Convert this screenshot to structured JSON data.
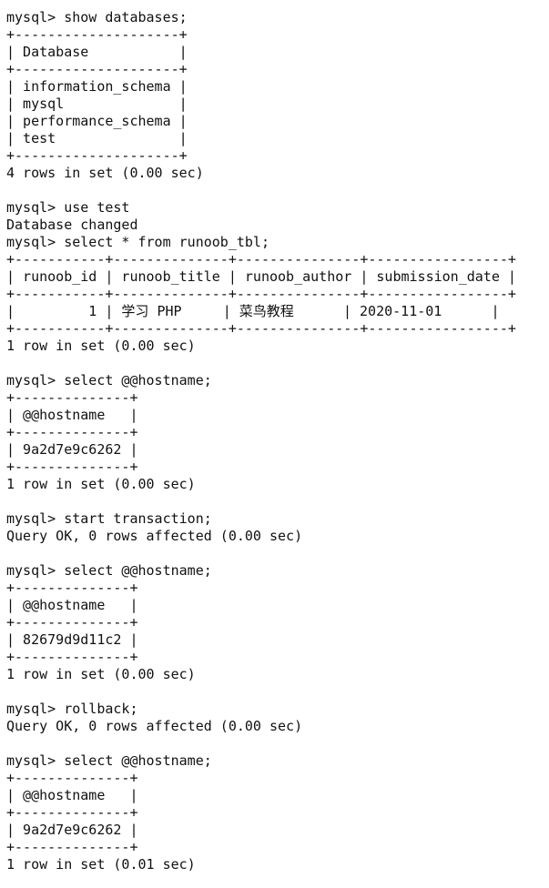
{
  "terminal": {
    "lines": [
      "mysql> show databases;",
      "+--------------------+",
      "| Database           |",
      "+--------------------+",
      "| information_schema |",
      "| mysql              |",
      "| performance_schema |",
      "| test               |",
      "+--------------------+",
      "4 rows in set (0.00 sec)",
      "",
      "mysql> use test",
      "Database changed",
      "mysql> select * from runoob_tbl;",
      "+-----------+--------------+---------------+-----------------+",
      "| runoob_id | runoob_title | runoob_author | submission_date |",
      "+-----------+--------------+---------------+-----------------+",
      "|         1 | 学习 PHP     | 菜鸟教程      | 2020-11-01      |",
      "+-----------+--------------+---------------+-----------------+",
      "1 row in set (0.00 sec)",
      "",
      "mysql> select @@hostname;",
      "+--------------+",
      "| @@hostname   |",
      "+--------------+",
      "| 9a2d7e9c6262 |",
      "+--------------+",
      "1 row in set (0.00 sec)",
      "",
      "mysql> start transaction;",
      "Query OK, 0 rows affected (0.00 sec)",
      "",
      "mysql> select @@hostname;",
      "+--------------+",
      "| @@hostname   |",
      "+--------------+",
      "| 82679d9d11c2 |",
      "+--------------+",
      "1 row in set (0.00 sec)",
      "",
      "mysql> rollback;",
      "Query OK, 0 rows affected (0.00 sec)",
      "",
      "mysql> select @@hostname;",
      "+--------------+",
      "| @@hostname   |",
      "+--------------+",
      "| 9a2d7e9c6262 |",
      "+--------------+",
      "1 row in set (0.01 sec)"
    ]
  }
}
